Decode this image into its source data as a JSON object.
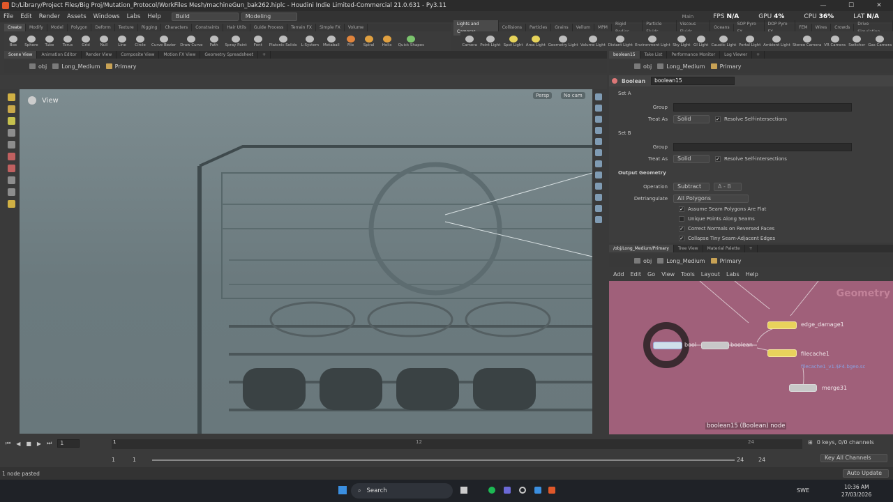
{
  "window": {
    "title": "D:/Library/Project Files/Big Proj/Mutation_Protocol/WorkFiles Mesh/machineGun_bak262.hiplc - Houdini Indie Limited-Commercial 21.0.631 - Py3.11",
    "minimize": "—",
    "maximize": "☐",
    "close": "✕"
  },
  "menu": {
    "items": [
      "File",
      "Edit",
      "Render",
      "Assets",
      "Windows",
      "Labs",
      "Help"
    ],
    "desktop": "Build",
    "desktop2": "Modeling",
    "main": "Main"
  },
  "stats": {
    "fps_label": "FPS",
    "fps": "N/A",
    "gpu_label": "GPU",
    "gpu": "4%",
    "cpu_label": "CPU",
    "cpu": "36%",
    "lat_label": "LAT",
    "lat": "N/A"
  },
  "shelf_tabs_left": [
    "Create",
    "Modify",
    "Model",
    "Polygon",
    "Deform",
    "Texture",
    "Rigging",
    "Characters",
    "Constraints",
    "Hair Utils",
    "Guide Process",
    "Terrain FX",
    "Simple FX",
    "Volume"
  ],
  "shelf_tabs_right": [
    "Lights and Cameras",
    "Collisions",
    "Particles",
    "Grains",
    "Vellum",
    "MPM",
    "Rigid Bodies",
    "Particle Fluids",
    "Viscous Fluids",
    "Oceans",
    "SOP Pyro FX",
    "DOP Pyro FX",
    "FEM",
    "Wires",
    "Crowds",
    "Drive Simulation"
  ],
  "tools_left": [
    "Box",
    "Sphere",
    "Tube",
    "Torus",
    "Grid",
    "Null",
    "Line",
    "Circle",
    "Curve Bezier",
    "Draw Curve",
    "Path",
    "Spray Paint",
    "Font",
    "Platonic Solids",
    "L-System",
    "Metaball",
    "File",
    "Spiral",
    "Helix",
    "Quick Shapes"
  ],
  "tools_right": [
    "Camera",
    "Point Light",
    "Spot Light",
    "Area Light",
    "Geometry Light",
    "Volume Light",
    "Distant Light",
    "Environment Light",
    "Sky Light",
    "GI Light",
    "Caustic Light",
    "Portal Light",
    "Ambient Light",
    "Stereo Camera",
    "VR Camera",
    "Switcher",
    "Gas Camera"
  ],
  "pane_tabs_left": [
    "Scene View",
    "Animation Editor",
    "Render View",
    "Composite View",
    "Motion FX View",
    "Geometry Spreadsheet"
  ],
  "pane_tabs_right": [
    "boolean15",
    "Take List",
    "Performance Monitor",
    "Log Viewer"
  ],
  "path": {
    "obj": "obj",
    "obj_node": "Long_Medium",
    "geo": "Primary"
  },
  "viewport": {
    "label": "View",
    "persp": "Persp",
    "cam": "No cam"
  },
  "params": {
    "node_type": "Boolean",
    "node_name": "boolean15",
    "setA": "Set A",
    "setB": "Set B",
    "group_label": "Group",
    "treat_as_label": "Treat As",
    "treat_a": "Solid",
    "treat_b": "Solid",
    "resolve": "Resolve Self-intersections",
    "output_geo": "Output Geometry",
    "operation_label": "Operation",
    "operation": "Subtract",
    "subtract_mode": "A - B",
    "detri_label": "Detriangulate",
    "detri": "All Polygons",
    "opts": [
      {
        "label": "Assume Seam Polygons Are Flat",
        "checked": true
      },
      {
        "label": "Unique Points Along Seams",
        "checked": false
      },
      {
        "label": "Correct Normals on Reversed Faces",
        "checked": true
      },
      {
        "label": "Collapse Tiny Seam-Adjacent Edges",
        "checked": true
      }
    ]
  },
  "network_tabs": [
    "/obj/Long_Medium/Primary",
    "Tree View",
    "Material Palette"
  ],
  "network_menu": [
    "Add",
    "Edit",
    "Go",
    "View",
    "Tools",
    "Layout",
    "Labs",
    "Help"
  ],
  "network": {
    "watermark": "Geometry",
    "nodes": {
      "edge": "edge_damage1",
      "bool_a": "bool",
      "bool_b": "boolean",
      "cache": "filecache1",
      "cache_sub": "filecache1_v1.$F4.bgeo.sc",
      "merge": "merge31"
    },
    "tooltip": "boolean15 (Boolean) node"
  },
  "timeline": {
    "frame": "1",
    "start": "1",
    "start2": "1",
    "end": "24",
    "end2": "24",
    "ticks": [
      "1",
      "12",
      "24"
    ],
    "keys": "0 keys, 0/0 channels",
    "key_all": "Key All Channels",
    "auto_update": "Auto Update",
    "status": "1 node pasted"
  },
  "taskbar": {
    "search": "Search",
    "lang": "SWE",
    "time": "10:36 AM",
    "date": "27/03/2026"
  }
}
